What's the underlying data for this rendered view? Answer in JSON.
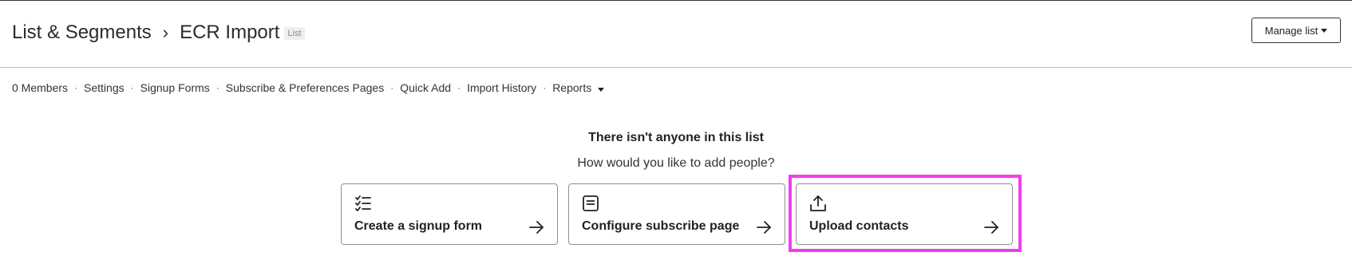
{
  "breadcrumb": {
    "root": "List & Segments",
    "separator": "›",
    "current": "ECR Import",
    "badge": "List"
  },
  "header": {
    "manage_label": "Manage list"
  },
  "subnav": {
    "separator": "·",
    "items": [
      "0 Members",
      "Settings",
      "Signup Forms",
      "Subscribe & Preferences Pages",
      "Quick Add",
      "Import History",
      "Reports"
    ]
  },
  "empty_state": {
    "title": "There isn't anyone in this list",
    "subtitle": "How would you like to add people?"
  },
  "cards": [
    {
      "label": "Create a signup form",
      "icon": "checklist-icon"
    },
    {
      "label": "Configure subscribe page",
      "icon": "document-icon"
    },
    {
      "label": "Upload contacts",
      "icon": "upload-icon"
    }
  ],
  "colors": {
    "highlight": "#f33cf0",
    "border": "#8f8f8f",
    "text": "#222222"
  }
}
